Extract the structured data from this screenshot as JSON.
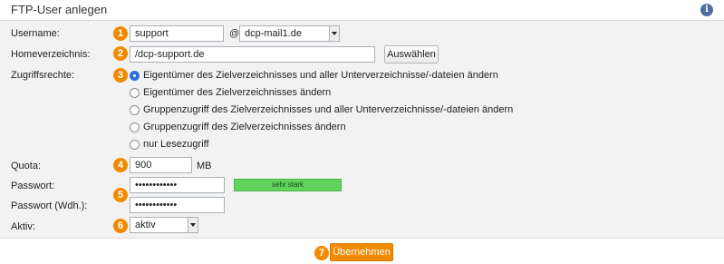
{
  "header": {
    "title": "FTP-User anlegen",
    "info_icon": "info-icon"
  },
  "badges": [
    "1",
    "2",
    "3",
    "4",
    "5",
    "6",
    "7"
  ],
  "colors": {
    "accent": "#f08a00",
    "strength": "#5fd35c",
    "radio_selected": "#2f6fd6"
  },
  "fields": {
    "username": {
      "label": "Username:",
      "value": "support",
      "at": "@",
      "domain": "dcp-mail1.de"
    },
    "home": {
      "label": "Homeverzeichnis:",
      "value": "/dcp-support.de",
      "button": "Auswählen"
    },
    "rights": {
      "label": "Zugriffsrechte:",
      "selected_index": 0,
      "options": [
        "Eigentümer des Zielverzeichnisses und aller Unterverzeichnisse/-dateien ändern",
        "Eigentümer des Zielverzeichnisses ändern",
        "Gruppenzugriff des Zielverzeichnisses und aller Unterverzeichnisse/-dateien ändern",
        "Gruppenzugriff des Zielverzeichnisses ändern",
        "nur Lesezugriff"
      ]
    },
    "quota": {
      "label": "Quota:",
      "value": "900",
      "unit": "MB"
    },
    "password": {
      "label": "Passwort:",
      "value": "••••••••••••",
      "strength": "sehr stark"
    },
    "password_repeat": {
      "label": "Passwort (Wdh.):",
      "value": "••••••••••••"
    },
    "active": {
      "label": "Aktiv:",
      "value": "aktiv"
    }
  },
  "submit": {
    "label": "Übernehmen"
  }
}
